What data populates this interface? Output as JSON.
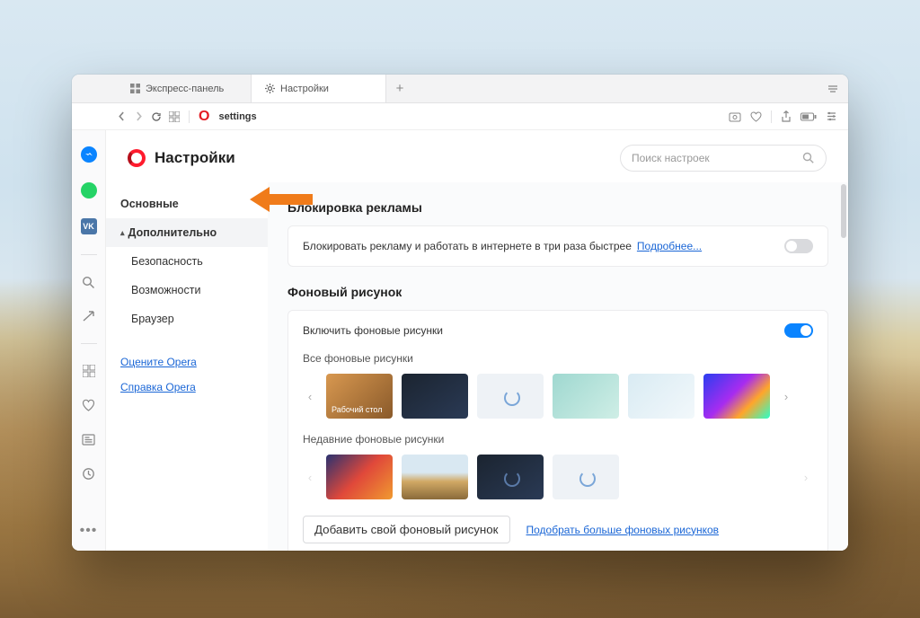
{
  "tabs": {
    "inactive": "Экспресс-панель",
    "active": "Настройки"
  },
  "address": {
    "url": "settings"
  },
  "header": {
    "title": "Настройки"
  },
  "search": {
    "placeholder": "Поиск настроек"
  },
  "sidebar": {
    "main": "Основные",
    "adv": "Дополнительно",
    "sec": "Безопасность",
    "feat": "Возможности",
    "browser": "Браузер",
    "rate": "Оцените Opera",
    "help": "Справка Opera"
  },
  "ads": {
    "heading": "Блокировка рекламы",
    "text": "Блокировать рекламу и работать в интернете в три раза быстрее",
    "more": "Подробнее..."
  },
  "wall": {
    "heading": "Фоновый рисунок",
    "enable": "Включить фоновые рисунки",
    "all": "Все фоновые рисунки",
    "recent": "Недавние фоновые рисунки",
    "desk": "Рабочий стол",
    "addbtn": "Добавить свой фоновый рисунок",
    "morelink": "Подобрать больше фоновых рисунков"
  },
  "leftbar": {
    "vk": "VK"
  }
}
